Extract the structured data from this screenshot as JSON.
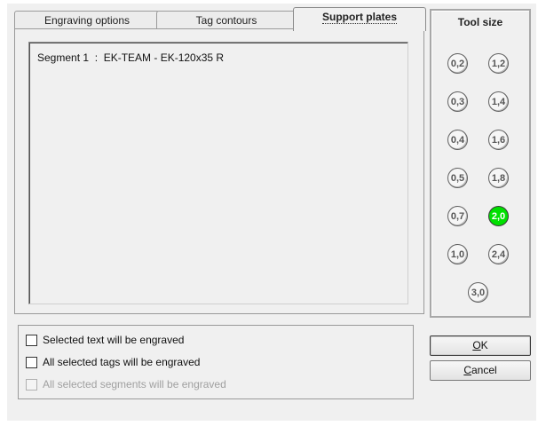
{
  "tabs": [
    {
      "label": "Engraving options",
      "active": false
    },
    {
      "label": "Tag contours",
      "active": false
    },
    {
      "label": "Support plates",
      "active": true
    }
  ],
  "list": {
    "items": [
      "Segment 1  :  EK-TEAM - EK-120x35 R"
    ]
  },
  "tool_size": {
    "title": "Tool size",
    "options": [
      "0,2",
      "1,2",
      "0,3",
      "1,4",
      "0,4",
      "1,6",
      "0,5",
      "1,8",
      "0,7",
      "2,0",
      "1,0",
      "2,4",
      "3,0"
    ],
    "selected": "2,0",
    "selected_color": "#00e000"
  },
  "options": [
    {
      "label": "Selected text will be engraved",
      "checked": false,
      "enabled": true
    },
    {
      "label": "All selected tags will be engraved",
      "checked": false,
      "enabled": true
    },
    {
      "label": "All selected segments will be engraved",
      "checked": false,
      "enabled": false
    }
  ],
  "buttons": {
    "ok": {
      "mnemonic": "O",
      "rest": "K"
    },
    "cancel": {
      "mnemonic": "C",
      "rest": "ancel"
    }
  }
}
